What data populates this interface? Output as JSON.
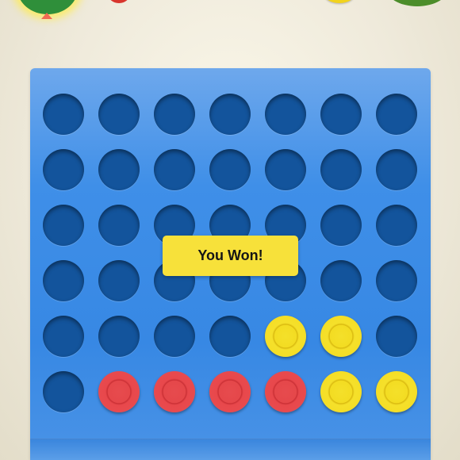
{
  "colors": {
    "board": "#3788e4",
    "hole": "#13549c",
    "red_piece": "#e5474a",
    "yellow_piece": "#f3dc22",
    "banner": "#f7e13a"
  },
  "header": {
    "left_player_icon": "avatar-icon",
    "left_player_chip": "red-chip-icon",
    "right_player_chip": "yellow-chip-icon",
    "right_player_icon": "avatar-icon"
  },
  "board": {
    "columns": 7,
    "rows": 6,
    "grid": [
      [
        "empty",
        "empty",
        "empty",
        "empty",
        "empty",
        "empty",
        "empty"
      ],
      [
        "empty",
        "empty",
        "empty",
        "empty",
        "empty",
        "empty",
        "empty"
      ],
      [
        "empty",
        "empty",
        "empty",
        "empty",
        "empty",
        "empty",
        "empty"
      ],
      [
        "empty",
        "empty",
        "empty",
        "empty",
        "empty",
        "empty",
        "empty"
      ],
      [
        "empty",
        "empty",
        "empty",
        "empty",
        "yellow",
        "yellow",
        "empty"
      ],
      [
        "empty",
        "red",
        "red",
        "red",
        "red",
        "yellow",
        "yellow"
      ]
    ]
  },
  "result": {
    "message": "You Won!"
  }
}
